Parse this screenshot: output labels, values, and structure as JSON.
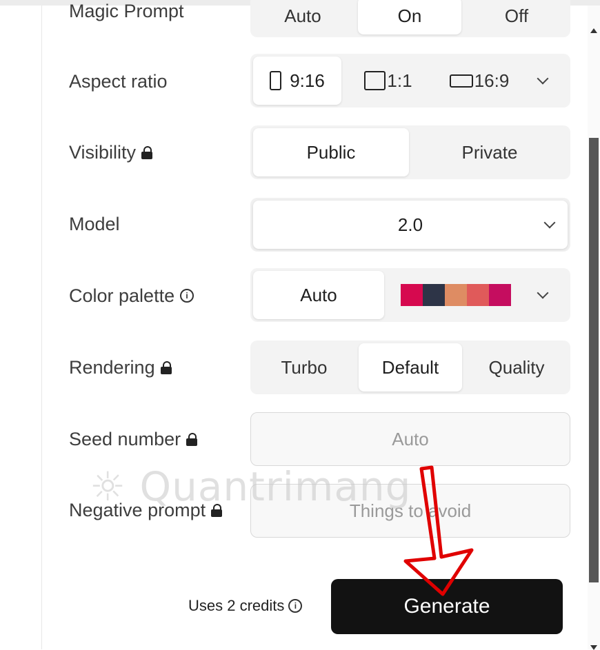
{
  "magic_prompt": {
    "label": "Magic Prompt",
    "options": [
      "Auto",
      "On",
      "Off"
    ],
    "selected": "On"
  },
  "aspect_ratio": {
    "label": "Aspect ratio",
    "options": [
      "9:16",
      "1:1",
      "16:9"
    ],
    "selected": "9:16"
  },
  "visibility": {
    "label": "Visibility",
    "options": [
      "Public",
      "Private"
    ],
    "selected": "Public"
  },
  "model": {
    "label": "Model",
    "value": "2.0"
  },
  "color_palette": {
    "label": "Color palette",
    "value": "Auto",
    "swatch_colors": [
      "#d6094f",
      "#2d3447",
      "#de8c63",
      "#e05a5a",
      "#c50d5f"
    ]
  },
  "rendering": {
    "label": "Rendering",
    "options": [
      "Turbo",
      "Default",
      "Quality"
    ],
    "selected": "Default"
  },
  "seed_number": {
    "label": "Seed number",
    "placeholder": "Auto"
  },
  "negative_prompt": {
    "label": "Negative prompt",
    "placeholder": "Things to avoid"
  },
  "footer": {
    "credits_text": "Uses 2 credits",
    "generate_label": "Generate"
  },
  "watermark": "Quantrimang",
  "colors": {
    "accent_button": "#121212",
    "annotation_arrow": "#e00000"
  }
}
